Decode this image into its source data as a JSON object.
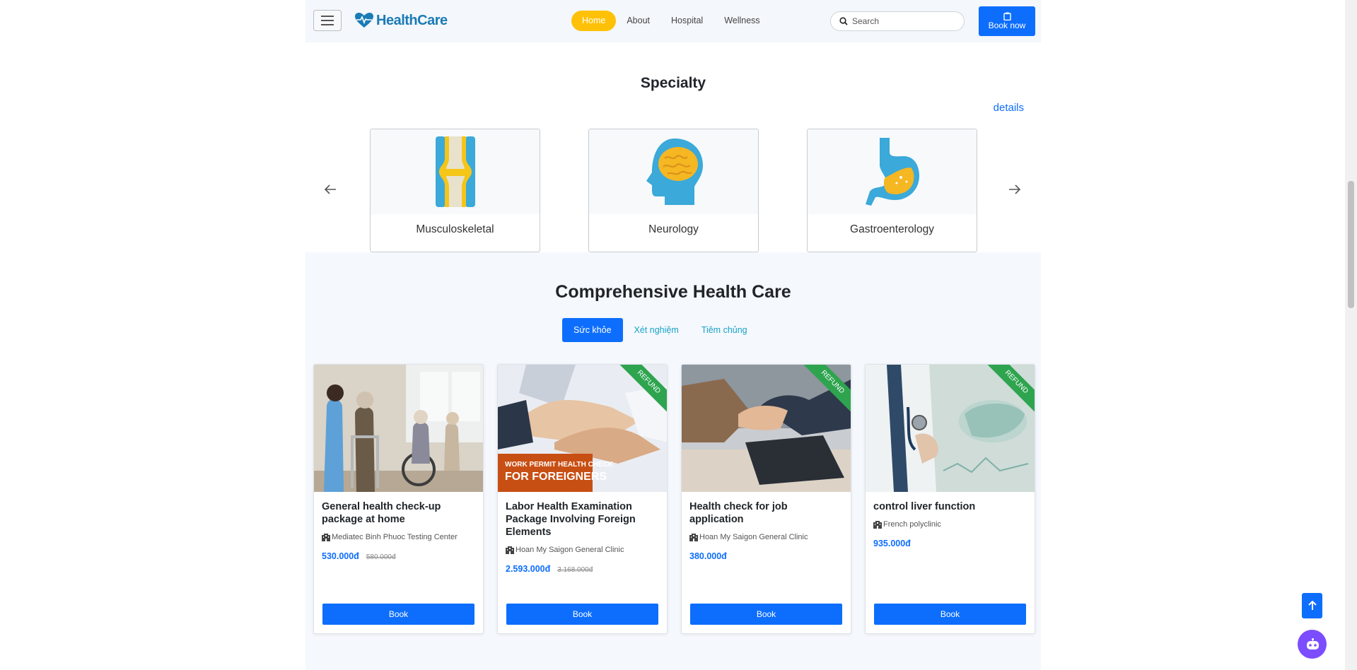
{
  "header": {
    "logo_text": "HealthCare",
    "nav": [
      "Home",
      "About",
      "Hospital",
      "Wellness"
    ],
    "search_placeholder": "Search",
    "book_now_label": "Book now"
  },
  "specialty": {
    "title": "Specialty",
    "details_label": "details",
    "items": [
      {
        "label": "Musculoskeletal",
        "icon": "knee-joint-icon"
      },
      {
        "label": "Neurology",
        "icon": "brain-head-icon"
      },
      {
        "label": "Gastroenterology",
        "icon": "stomach-icon"
      }
    ]
  },
  "comprehensive": {
    "title": "Comprehensive Health Care",
    "tabs": [
      "Sức khỏe",
      "Xét nghiệm",
      "Tiêm chủng"
    ],
    "cards": [
      {
        "title": "General health check-up package at home",
        "clinic": "Mediatec Binh Phuoc Testing Center",
        "price": "530.000đ",
        "old_price": "580.000đ",
        "ribbon": "",
        "button": "Book"
      },
      {
        "title": "Labor Health Examination Package Involving Foreign Elements",
        "clinic": "Hoan My Saigon General Clinic",
        "price": "2.593.000đ",
        "old_price": "3.168.000đ",
        "ribbon": "REFUND",
        "image_text_1": "WORK PERMIT HEALTH CHECK",
        "image_text_2": "FOR FOREIGNERS",
        "button": "Book"
      },
      {
        "title": "Health check for job application",
        "clinic": "Hoan My Saigon General Clinic",
        "price": "380.000đ",
        "old_price": "",
        "ribbon": "REFUND",
        "button": "Book"
      },
      {
        "title": "control liver function",
        "clinic": "French polyclinic",
        "price": "935.000đ",
        "old_price": "",
        "ribbon": "REFUND",
        "button": "Book"
      }
    ]
  },
  "colors": {
    "primary": "#0d6efd",
    "accent": "#ffc107",
    "ribbon": "#2ea44f",
    "chatbot": "#7c4dff"
  }
}
